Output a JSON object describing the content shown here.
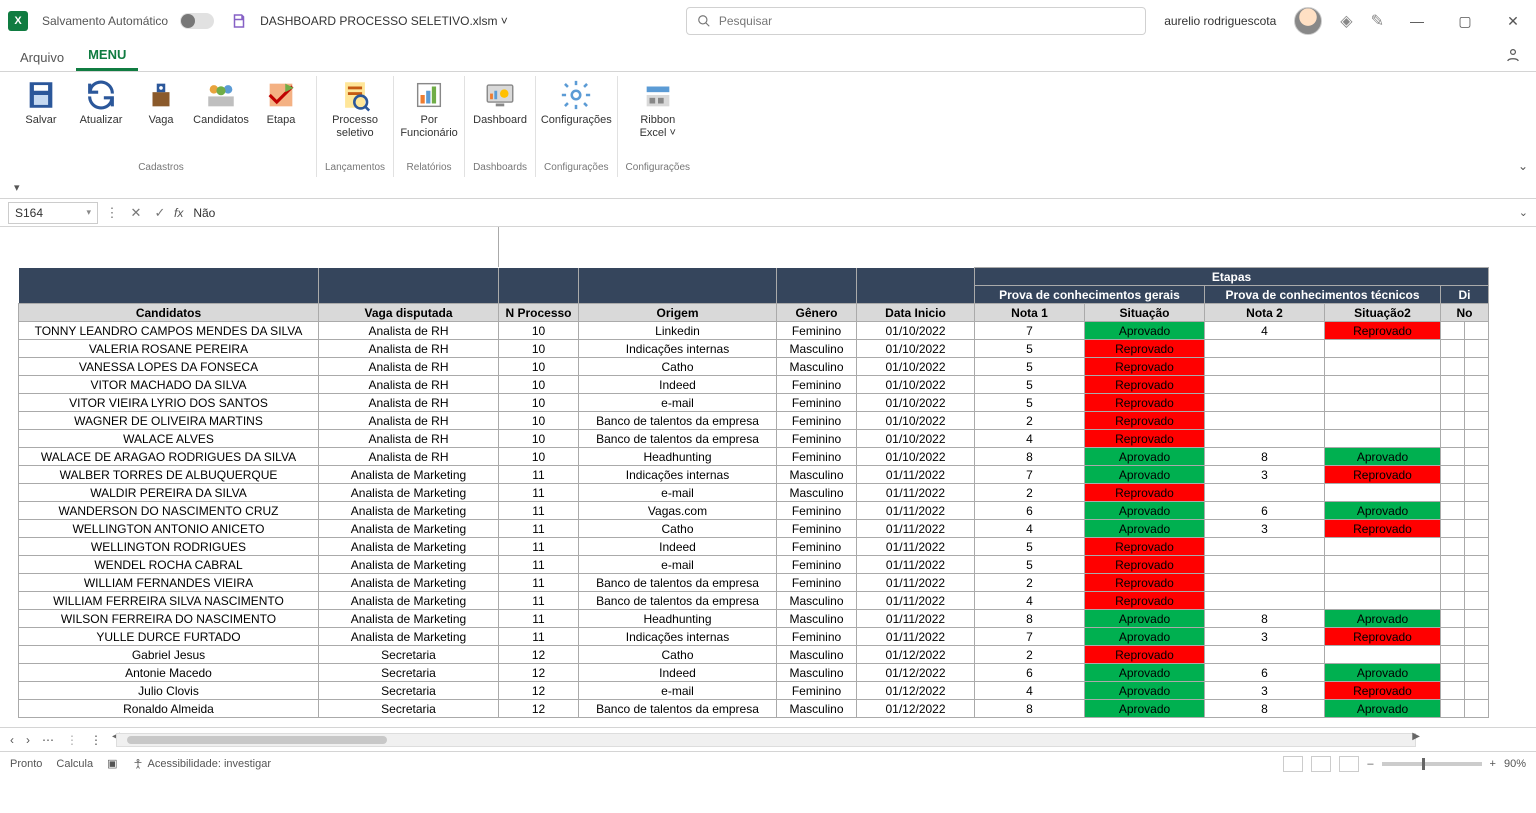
{
  "titlebar": {
    "autosave": "Salvamento Automático",
    "filename": "DASHBOARD PROCESSO SELETIVO.xlsm",
    "search_placeholder": "Pesquisar",
    "username": "aurelio rodriguescota"
  },
  "tabs": {
    "file": "Arquivo",
    "menu": "MENU"
  },
  "ribbon": {
    "groups": [
      {
        "label": "Cadastros",
        "items": [
          {
            "name": "salvar",
            "label": "Salvar"
          },
          {
            "name": "atualizar",
            "label": "Atualizar"
          },
          {
            "name": "vaga",
            "label": "Vaga"
          },
          {
            "name": "candidatos",
            "label": "Candidatos"
          },
          {
            "name": "etapa",
            "label": "Etapa"
          }
        ]
      },
      {
        "label": "Lançamentos",
        "items": [
          {
            "name": "processo",
            "label": "Processo seletivo"
          }
        ]
      },
      {
        "label": "Relatórios",
        "items": [
          {
            "name": "porfunc",
            "label": "Por Funcionário"
          }
        ]
      },
      {
        "label": "Dashboards",
        "items": [
          {
            "name": "dashboard",
            "label": "Dashboard"
          }
        ]
      },
      {
        "label": "Configurações",
        "items": [
          {
            "name": "config",
            "label": "Configurações"
          }
        ]
      },
      {
        "label": "Configurações",
        "items": [
          {
            "name": "ribbonexcel",
            "label": "Ribbon Excel ˅"
          }
        ]
      }
    ]
  },
  "formula": {
    "ref": "S164",
    "value": "Não"
  },
  "headers": {
    "etapas": "Etapas",
    "candidatos": "Candidatos",
    "vaga": "Vaga disputada",
    "processo": "N Processo",
    "origem": "Origem",
    "genero": "Gênero",
    "data": "Data Inicio",
    "prova1": "Prova de conhecimentos gerais",
    "prova2": "Prova de conhecimentos técnicos",
    "di": "Di",
    "nota1": "Nota 1",
    "sit1": "Situação",
    "nota2": "Nota 2",
    "sit2": "Situação2",
    "no": "No"
  },
  "rows": [
    {
      "n": "TONNY LEANDRO CAMPOS MENDES DA SILVA",
      "v": "Analista de RH",
      "p": "10",
      "o": "Linkedin",
      "g": "Feminino",
      "d": "01/10/2022",
      "n1": "7",
      "s1": "Aprovado",
      "n2": "4",
      "s2": "Reprovado"
    },
    {
      "n": "VALERIA ROSANE PEREIRA",
      "v": "Analista de RH",
      "p": "10",
      "o": "Indicações internas",
      "g": "Masculino",
      "d": "01/10/2022",
      "n1": "5",
      "s1": "Reprovado",
      "n2": "",
      "s2": ""
    },
    {
      "n": "VANESSA LOPES DA FONSECA",
      "v": "Analista de RH",
      "p": "10",
      "o": "Catho",
      "g": "Masculino",
      "d": "01/10/2022",
      "n1": "5",
      "s1": "Reprovado",
      "n2": "",
      "s2": ""
    },
    {
      "n": "VITOR MACHADO DA SILVA",
      "v": "Analista de RH",
      "p": "10",
      "o": "Indeed",
      "g": "Feminino",
      "d": "01/10/2022",
      "n1": "5",
      "s1": "Reprovado",
      "n2": "",
      "s2": ""
    },
    {
      "n": "VITOR VIEIRA LYRIO DOS SANTOS",
      "v": "Analista de RH",
      "p": "10",
      "o": "e-mail",
      "g": "Feminino",
      "d": "01/10/2022",
      "n1": "5",
      "s1": "Reprovado",
      "n2": "",
      "s2": ""
    },
    {
      "n": "WAGNER DE OLIVEIRA MARTINS",
      "v": "Analista de RH",
      "p": "10",
      "o": "Banco de talentos da empresa",
      "g": "Feminino",
      "d": "01/10/2022",
      "n1": "2",
      "s1": "Reprovado",
      "n2": "",
      "s2": ""
    },
    {
      "n": "WALACE ALVES",
      "v": "Analista de RH",
      "p": "10",
      "o": "Banco de talentos da empresa",
      "g": "Feminino",
      "d": "01/10/2022",
      "n1": "4",
      "s1": "Reprovado",
      "n2": "",
      "s2": ""
    },
    {
      "n": "WALACE DE ARAGAO RODRIGUES DA SILVA",
      "v": "Analista de RH",
      "p": "10",
      "o": "Headhunting",
      "g": "Feminino",
      "d": "01/10/2022",
      "n1": "8",
      "s1": "Aprovado",
      "n2": "8",
      "s2": "Aprovado"
    },
    {
      "n": "WALBER TORRES DE ALBUQUERQUE",
      "v": "Analista de Marketing",
      "p": "11",
      "o": "Indicações internas",
      "g": "Masculino",
      "d": "01/11/2022",
      "n1": "7",
      "s1": "Aprovado",
      "n2": "3",
      "s2": "Reprovado"
    },
    {
      "n": "WALDIR PEREIRA DA SILVA",
      "v": "Analista de Marketing",
      "p": "11",
      "o": "e-mail",
      "g": "Masculino",
      "d": "01/11/2022",
      "n1": "2",
      "s1": "Reprovado",
      "n2": "",
      "s2": ""
    },
    {
      "n": "WANDERSON DO NASCIMENTO CRUZ",
      "v": "Analista de Marketing",
      "p": "11",
      "o": "Vagas.com",
      "g": "Feminino",
      "d": "01/11/2022",
      "n1": "6",
      "s1": "Aprovado",
      "n2": "6",
      "s2": "Aprovado"
    },
    {
      "n": "WELLINGTON ANTONIO ANICETO",
      "v": "Analista de Marketing",
      "p": "11",
      "o": "Catho",
      "g": "Feminino",
      "d": "01/11/2022",
      "n1": "4",
      "s1": "Aprovado",
      "n2": "3",
      "s2": "Reprovado"
    },
    {
      "n": "WELLINGTON RODRIGUES",
      "v": "Analista de Marketing",
      "p": "11",
      "o": "Indeed",
      "g": "Feminino",
      "d": "01/11/2022",
      "n1": "5",
      "s1": "Reprovado",
      "n2": "",
      "s2": ""
    },
    {
      "n": "WENDEL ROCHA CABRAL",
      "v": "Analista de Marketing",
      "p": "11",
      "o": "e-mail",
      "g": "Feminino",
      "d": "01/11/2022",
      "n1": "5",
      "s1": "Reprovado",
      "n2": "",
      "s2": ""
    },
    {
      "n": "WILLIAM FERNANDES VIEIRA",
      "v": "Analista de Marketing",
      "p": "11",
      "o": "Banco de talentos da empresa",
      "g": "Feminino",
      "d": "01/11/2022",
      "n1": "2",
      "s1": "Reprovado",
      "n2": "",
      "s2": ""
    },
    {
      "n": "WILLIAM FERREIRA SILVA NASCIMENTO",
      "v": "Analista de Marketing",
      "p": "11",
      "o": "Banco de talentos da empresa",
      "g": "Masculino",
      "d": "01/11/2022",
      "n1": "4",
      "s1": "Reprovado",
      "n2": "",
      "s2": ""
    },
    {
      "n": "WILSON FERREIRA DO NASCIMENTO",
      "v": "Analista de Marketing",
      "p": "11",
      "o": "Headhunting",
      "g": "Masculino",
      "d": "01/11/2022",
      "n1": "8",
      "s1": "Aprovado",
      "n2": "8",
      "s2": "Aprovado"
    },
    {
      "n": "YULLE DURCE FURTADO",
      "v": "Analista de Marketing",
      "p": "11",
      "o": "Indicações internas",
      "g": "Feminino",
      "d": "01/11/2022",
      "n1": "7",
      "s1": "Aprovado",
      "n2": "3",
      "s2": "Reprovado"
    },
    {
      "n": "Gabriel Jesus",
      "v": "Secretaria",
      "p": "12",
      "o": "Catho",
      "g": "Masculino",
      "d": "01/12/2022",
      "n1": "2",
      "s1": "Reprovado",
      "n2": "",
      "s2": ""
    },
    {
      "n": "Antonie Macedo",
      "v": "Secretaria",
      "p": "12",
      "o": "Indeed",
      "g": "Masculino",
      "d": "01/12/2022",
      "n1": "6",
      "s1": "Aprovado",
      "n2": "6",
      "s2": "Aprovado"
    },
    {
      "n": "Julio Clovis",
      "v": "Secretaria",
      "p": "12",
      "o": "e-mail",
      "g": "Feminino",
      "d": "01/12/2022",
      "n1": "4",
      "s1": "Aprovado",
      "n2": "3",
      "s2": "Reprovado"
    },
    {
      "n": "Ronaldo Almeida",
      "v": "Secretaria",
      "p": "12",
      "o": "Banco de talentos da empresa",
      "g": "Masculino",
      "d": "01/12/2022",
      "n1": "8",
      "s1": "Aprovado",
      "n2": "8",
      "s2": "Aprovado"
    }
  ],
  "status": {
    "ready": "Pronto",
    "calc": "Calcula",
    "access": "Acessibilidade: investigar",
    "zoom": "90%"
  }
}
